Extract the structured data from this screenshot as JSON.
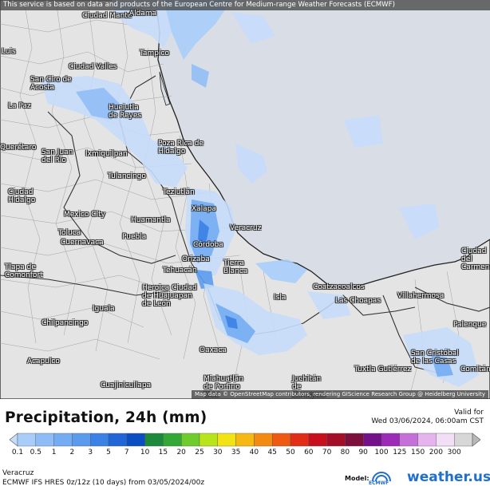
{
  "banner": "This service is based on data and products of the European Centre for Medium-range Weather Forecasts (ECMWF)",
  "attribution": "Map data © OpenStreetMap contributors, rendering GIScience Research Group @ Heidelberg University",
  "cities": {
    "ciudad_mante": "Ciudad Mante",
    "aldama": "Aldama",
    "tampico": "Tampico",
    "ciudad_valles": "Ciudad Valles",
    "luis": "Luis",
    "san_ciro": "San Ciro de Acosta",
    "la_paz": "La Paz",
    "huejutla": "Huejutla de Reyes",
    "queretaro": "Querétaro",
    "san_juan": "San Juan del Río",
    "ixmiquilpan": "Ixmiquilpan",
    "poza_rica": "Poza Rica de Hidalgo",
    "tulancingo": "Tulancingo",
    "teziutlan": "Teziutlán",
    "ciudad_hidalgo": "Ciudad Hidalgo",
    "xalapa": "Xalapa",
    "veracruz": "Veracruz",
    "mexico_city": "Mexico City",
    "toluca": "Toluca",
    "huamantla": "Huamantla",
    "cuernavaca": "Cuernavaca",
    "puebla": "Puebla",
    "cordoba": "Córdoba",
    "orizaba": "Orizaba",
    "tehuacan": "Tehuacán",
    "tierra_blanca": "Tierra Blanca",
    "heroica": "Heroica Ciudad de Huajuapan de León",
    "coatzacoalcos": "Coatzacoalcos",
    "las_choapas": "Las Choapas",
    "villahermosa": "Villahermosa",
    "ciudad_carmen": "Ciudad del Carmen",
    "iguala": "Iguala",
    "tlapa": "Tlapa de Comonfort",
    "chilpancingo": "Chilpancingo",
    "isla": "Isla",
    "acapulco": "Acapulco",
    "oaxaca": "Oaxaca",
    "tuxtla": "Tuxtla Gutiérrez",
    "san_cristobal": "San Cristóbal de las Casas",
    "palenque": "Palenque",
    "comitan": "Comitán",
    "miahuatlan": "Miahuatlán de Porfirio Díaz",
    "juchitan": "Juchitán de Zaragoza",
    "cuajinicuilapa": "Cuajinicuilapa"
  },
  "legend": {
    "title": "Precipitation, 24h (mm)",
    "valid_label": "Valid for",
    "valid_time": "Wed 03/06/2024, 06:00am CST",
    "ticks": [
      "0.1",
      "0.5",
      "1",
      "2",
      "3",
      "5",
      "7",
      "10",
      "15",
      "20",
      "25",
      "30",
      "35",
      "40",
      "45",
      "50",
      "60",
      "70",
      "80",
      "90",
      "100",
      "125",
      "150",
      "200",
      "300"
    ],
    "colors": [
      "#c5dcfb",
      "#a9cdf9",
      "#8ebcf6",
      "#73acf3",
      "#5b9bee",
      "#3b82e6",
      "#2166d6",
      "#0a4ec3",
      "#1c8a3a",
      "#33a836",
      "#6fcc2e",
      "#b8e41b",
      "#f2e414",
      "#f6b812",
      "#f38b10",
      "#ee5a11",
      "#e12d14",
      "#c8101c",
      "#a30f26",
      "#7d0f3d",
      "#74118a",
      "#9c2bb8",
      "#c56fd9",
      "#e5b4ee",
      "#f2dff5",
      "#d7d7d7",
      "#b8b8b8"
    ],
    "region": "Veracruz",
    "model_run": "ECMWF IFS HRES 0z/12z (10 days) from 03/05/2024/00z",
    "brand_model_label": "Model:",
    "brand_model_name": "ECMWF",
    "brand_name": "weather.us"
  }
}
